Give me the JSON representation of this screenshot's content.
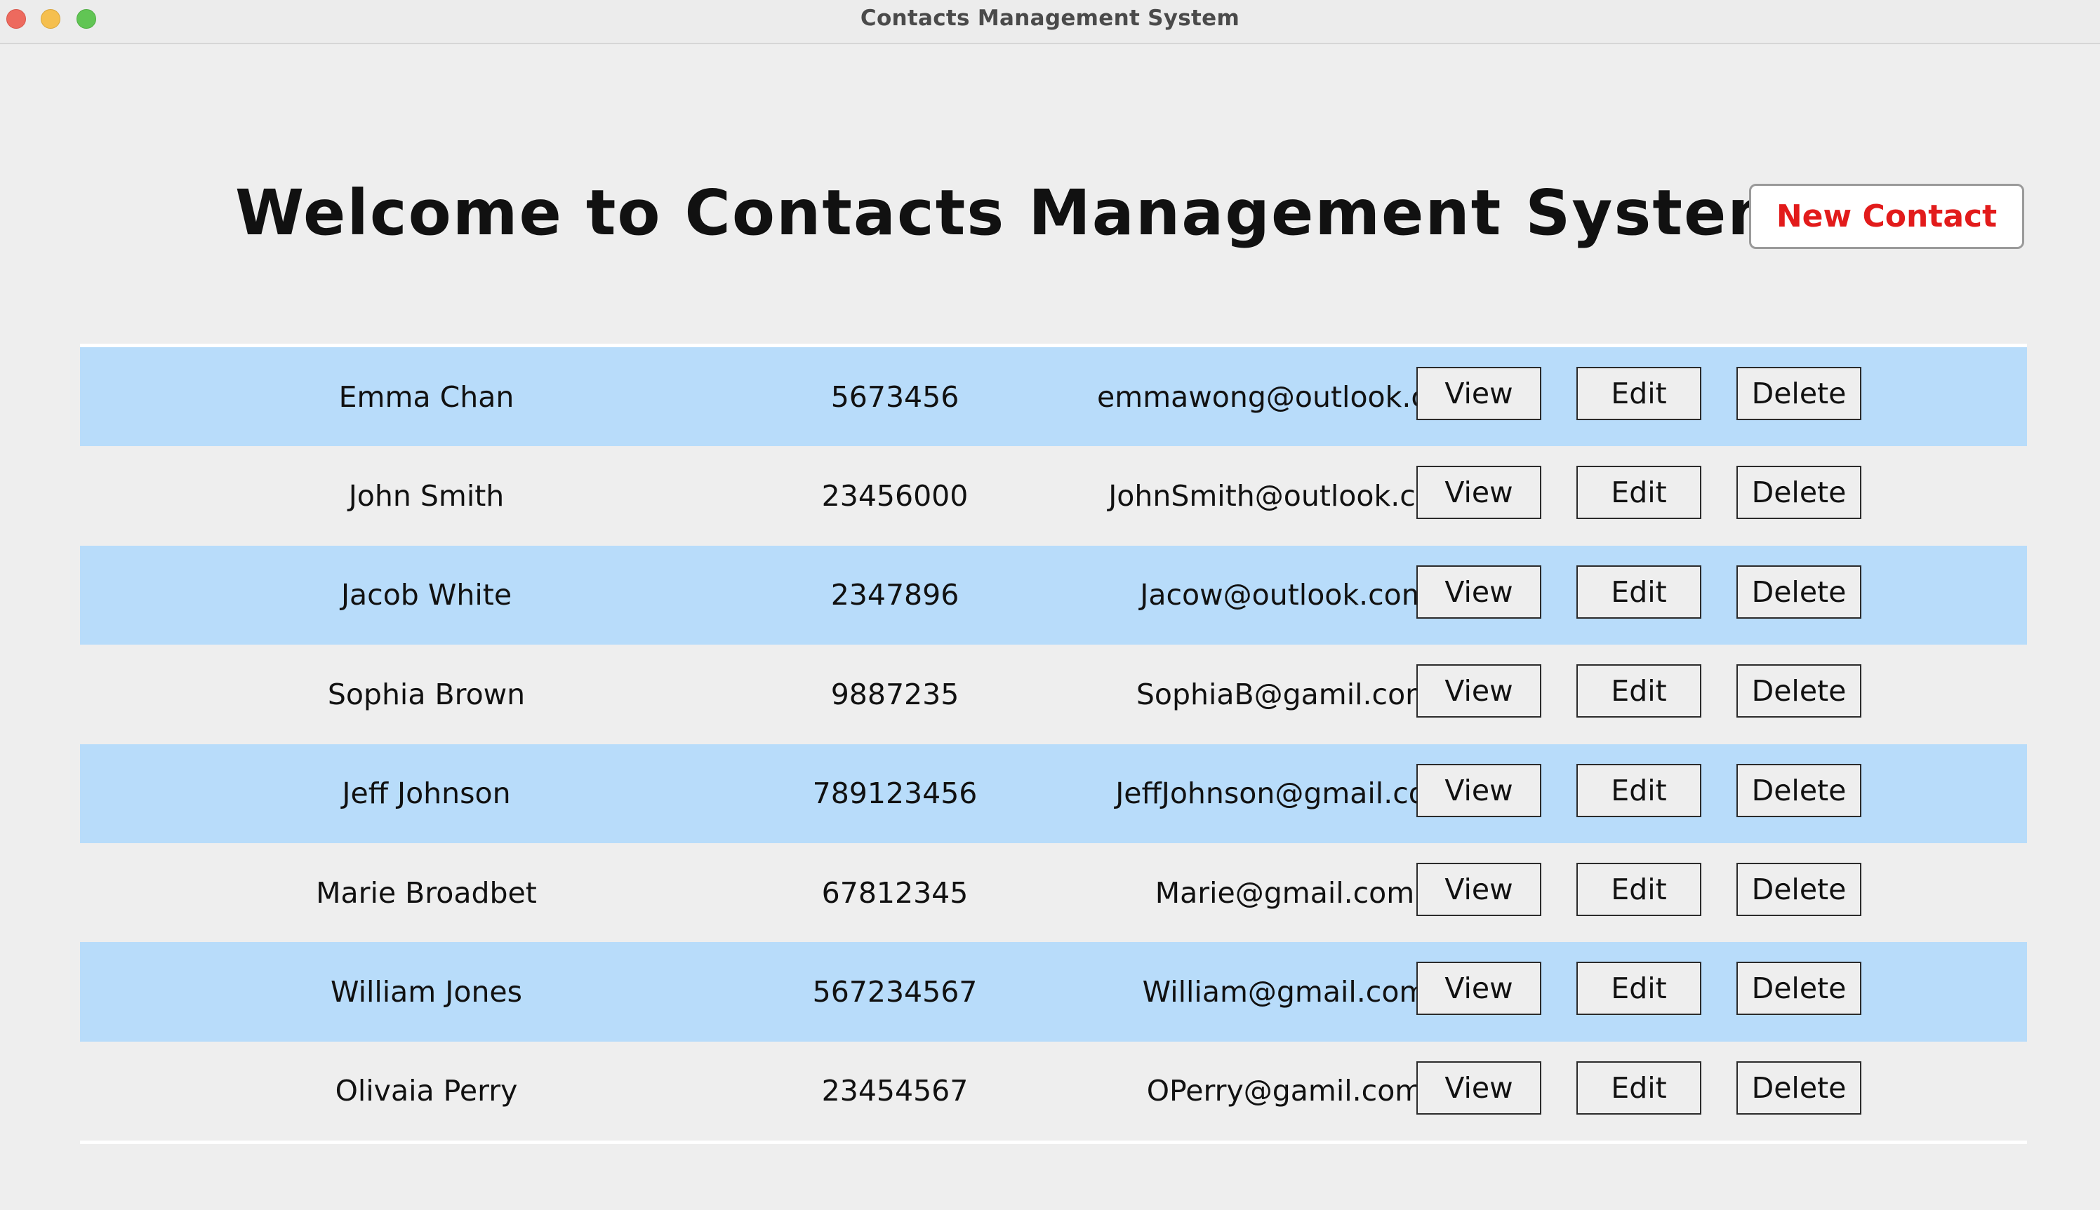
{
  "window": {
    "title": "Contacts Management System"
  },
  "header": {
    "welcome": "Welcome to Contacts Management System",
    "new_contact_label": "New Contact"
  },
  "colors": {
    "row_shade": "#b8dcfa",
    "accent_red": "#e21b1b",
    "background": "#eeeeee"
  },
  "actions": {
    "view": "View",
    "edit": "Edit",
    "delete": "Delete"
  },
  "contacts": [
    {
      "name": "Emma Chan",
      "phone": "5673456",
      "email": "emmawong@outlook.com"
    },
    {
      "name": "John Smith",
      "phone": "23456000",
      "email": "JohnSmith@outlook.com"
    },
    {
      "name": "Jacob White",
      "phone": "2347896",
      "email": "Jacow@outlook.com"
    },
    {
      "name": "Sophia Brown",
      "phone": "9887235",
      "email": "SophiaB@gamil.com"
    },
    {
      "name": "Jeff Johnson",
      "phone": "789123456",
      "email": "JeffJohnson@gmail.com"
    },
    {
      "name": "Marie Broadbet",
      "phone": "67812345",
      "email": "Marie@gmail.com"
    },
    {
      "name": "William Jones",
      "phone": "567234567",
      "email": "William@gmail.com"
    },
    {
      "name": "Olivaia Perry",
      "phone": "23454567",
      "email": "OPerry@gamil.com"
    }
  ]
}
